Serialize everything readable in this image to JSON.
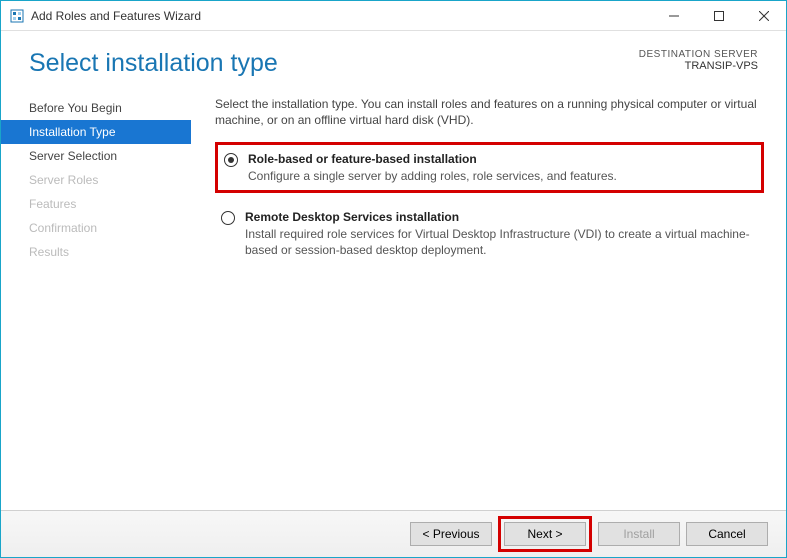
{
  "window": {
    "title": "Add Roles and Features Wizard"
  },
  "header": {
    "heading": "Select installation type",
    "destination_label": "DESTINATION SERVER",
    "destination_name": "TRANSIP-VPS"
  },
  "sidebar": {
    "steps": [
      {
        "label": "Before You Begin",
        "state": "enabled"
      },
      {
        "label": "Installation Type",
        "state": "active"
      },
      {
        "label": "Server Selection",
        "state": "enabled"
      },
      {
        "label": "Server Roles",
        "state": "disabled"
      },
      {
        "label": "Features",
        "state": "disabled"
      },
      {
        "label": "Confirmation",
        "state": "disabled"
      },
      {
        "label": "Results",
        "state": "disabled"
      }
    ]
  },
  "content": {
    "intro": "Select the installation type. You can install roles and features on a running physical computer or virtual machine, or on an offline virtual hard disk (VHD).",
    "options": [
      {
        "title": "Role-based or feature-based installation",
        "description": "Configure a single server by adding roles, role services, and features.",
        "selected": true,
        "highlighted": true
      },
      {
        "title": "Remote Desktop Services installation",
        "description": "Install required role services for Virtual Desktop Infrastructure (VDI) to create a virtual machine-based or session-based desktop deployment.",
        "selected": false,
        "highlighted": false
      }
    ]
  },
  "footer": {
    "previous": "< Previous",
    "next": "Next >",
    "install": "Install",
    "cancel": "Cancel"
  }
}
